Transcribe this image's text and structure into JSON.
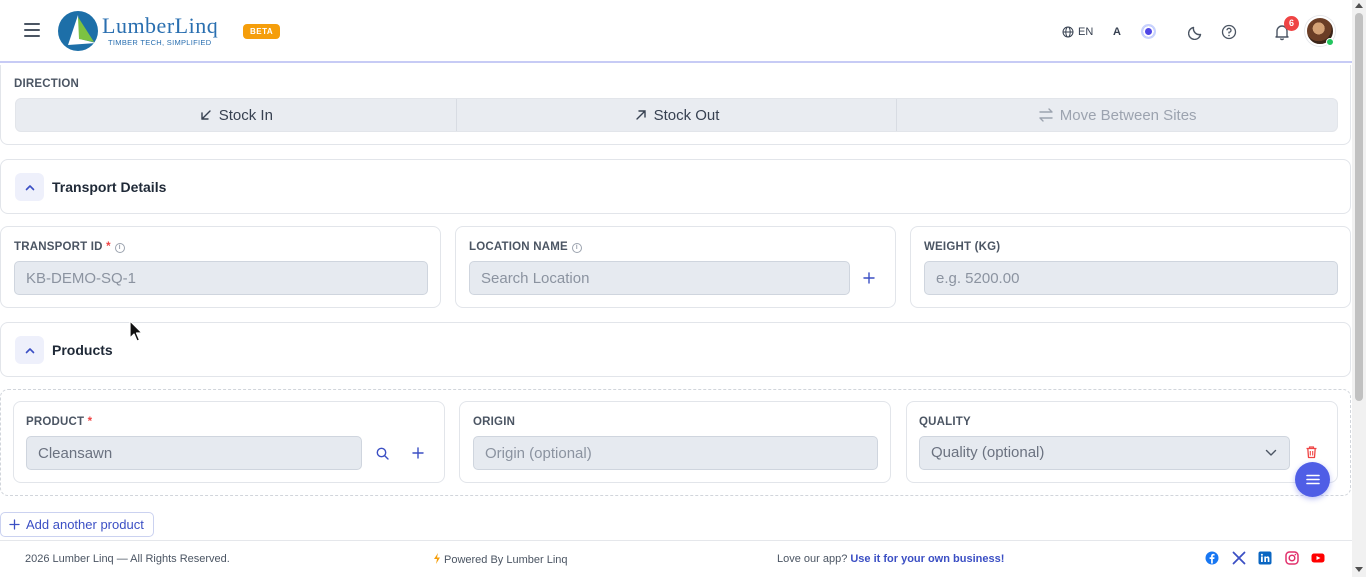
{
  "header": {
    "brand_name": "LumberLinq",
    "brand_tagline": "TIMBER TECH, SIMPLIFIED",
    "beta_label": "BETA",
    "language": "EN",
    "font_toggle": "A",
    "notification_count": "6",
    "icons": [
      "menu-icon",
      "globe-icon",
      "theme-color-icon",
      "moon-icon",
      "help-icon",
      "bell-icon"
    ]
  },
  "direction": {
    "label": "DIRECTION",
    "options": [
      {
        "label": "Stock In",
        "icon": "arrow-down-left-icon"
      },
      {
        "label": "Stock Out",
        "icon": "arrow-up-right-icon"
      },
      {
        "label": "Move Between Sites",
        "icon": "arrows-exchange-icon"
      }
    ]
  },
  "transport_section": {
    "title": "Transport Details"
  },
  "transport_fields": {
    "transport_id": {
      "label": "TRANSPORT ID",
      "required": "*",
      "placeholder": "KB-DEMO-SQ-1"
    },
    "location_name": {
      "label": "LOCATION NAME",
      "placeholder": "Search Location"
    },
    "weight": {
      "label": "WEIGHT (KG)",
      "placeholder": "e.g. 5200.00"
    }
  },
  "products_section": {
    "title": "Products"
  },
  "product_row": {
    "product": {
      "label": "PRODUCT",
      "required": "*",
      "value": "Cleansawn"
    },
    "origin": {
      "label": "ORIGIN",
      "placeholder": "Origin (optional)"
    },
    "quality": {
      "label": "QUALITY",
      "value": "Quality (optional)"
    }
  },
  "add_product_label": "Add another product",
  "footer": {
    "copyright": "2026 Lumber Linq — All Rights Reserved.",
    "powered": "Powered By Lumber Linq",
    "love_text": "Love our app?",
    "love_link": "Use it for your own business!",
    "social": [
      "facebook-icon",
      "x-icon",
      "linkedin-icon",
      "instagram-icon",
      "youtube-icon"
    ]
  },
  "colors": {
    "accent": "#4f5ee6",
    "beta": "#f59e0b",
    "danger": "#ef4444",
    "brand": "#2a6fb0"
  }
}
